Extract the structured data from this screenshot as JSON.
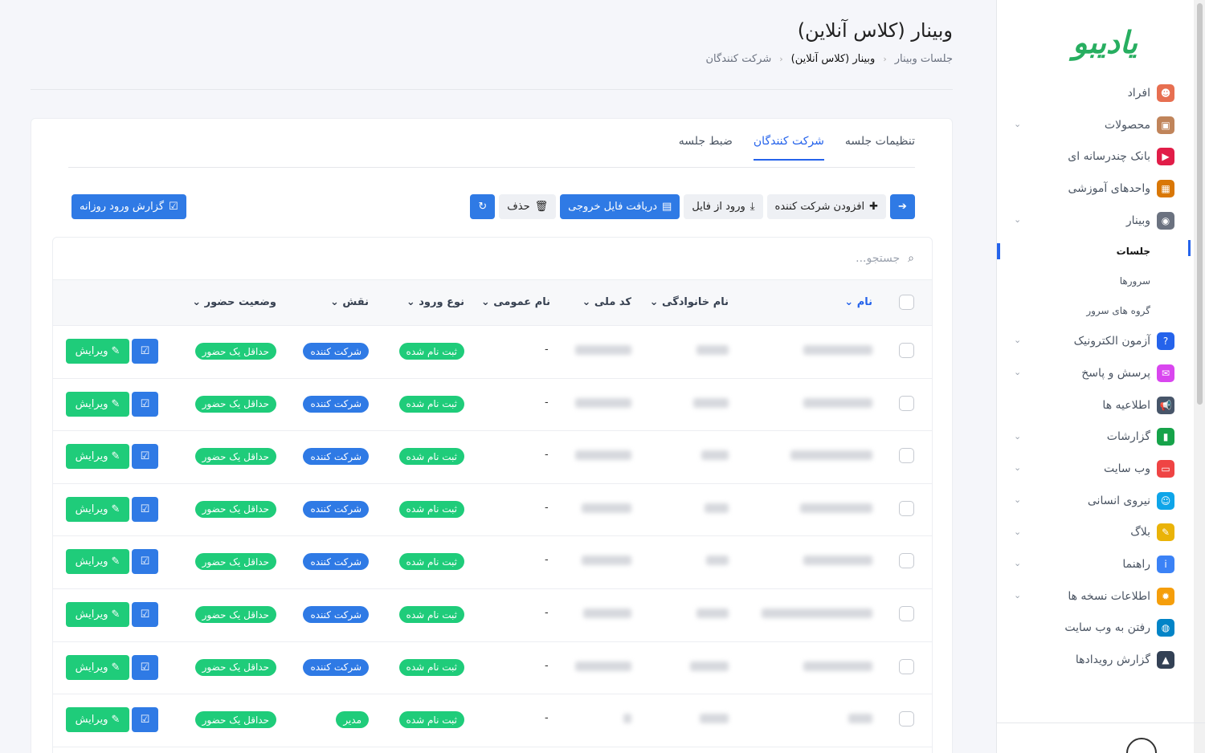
{
  "brand": {
    "logo_text": "یادیبو"
  },
  "sidebar": {
    "items": [
      {
        "label": "افراد",
        "icon": "person-icon",
        "color": "#e76f51",
        "chevron": false
      },
      {
        "label": "محصولات",
        "icon": "box-icon",
        "color": "#c0845a",
        "chevron": true
      },
      {
        "label": "بانک چندرسانه ای",
        "icon": "play-icon",
        "color": "#e11d48",
        "chevron": false
      },
      {
        "label": "واحدهای آموزشی",
        "icon": "school-icon",
        "color": "#d97706",
        "chevron": false
      },
      {
        "label": "وبینار",
        "icon": "webinar-icon",
        "color": "#6b7280",
        "chevron": true
      }
    ],
    "sub_items": [
      {
        "label": "جلسات",
        "active": true
      },
      {
        "label": "سرورها",
        "active": false
      },
      {
        "label": "گروه های سرور",
        "active": false
      }
    ],
    "items2": [
      {
        "label": "آزمون الکترونیک",
        "icon": "question-icon",
        "color": "#2563eb",
        "chevron": true
      },
      {
        "label": "پرسش و پاسخ",
        "icon": "chat-icon",
        "color": "#d946ef",
        "chevron": true
      },
      {
        "label": "اطلاعیه ها",
        "icon": "megaphone-icon",
        "color": "#475569",
        "chevron": false
      },
      {
        "label": "گزارشات",
        "icon": "bar-chart-icon",
        "color": "#16a34a",
        "chevron": true
      },
      {
        "label": "وب سایت",
        "icon": "browser-icon",
        "color": "#ef4444",
        "chevron": true
      },
      {
        "label": "نیروی انسانی",
        "icon": "team-icon",
        "color": "#0ea5e9",
        "chevron": true
      },
      {
        "label": "بلاگ",
        "icon": "pencil-icon",
        "color": "#eab308",
        "chevron": true
      },
      {
        "label": "راهنما",
        "icon": "info-icon",
        "color": "#3b82f6",
        "chevron": true
      },
      {
        "label": "اطلاعات نسخه ها",
        "icon": "gear-icon",
        "color": "#f59e0b",
        "chevron": true
      },
      {
        "label": "رفتن به وب سایت",
        "icon": "globe-icon",
        "color": "#0284c7",
        "chevron": false
      },
      {
        "label": "گزارش رویدادها",
        "icon": "warning-icon",
        "color": "#334155",
        "chevron": false
      }
    ]
  },
  "header": {
    "title": "وبینار (کلاس آنلاین)",
    "breadcrumb": [
      "جلسات وبینار",
      "وبینار (کلاس آنلاین)",
      "شرکت کنندگان"
    ]
  },
  "tabs": [
    {
      "label": "تنظیمات جلسه",
      "active": false
    },
    {
      "label": "شرکت کنندگان",
      "active": true
    },
    {
      "label": "ضبط جلسه",
      "active": false
    }
  ],
  "toolbar": {
    "add_label": "افزودن شرکت کننده",
    "import_label": "ورود از فایل",
    "export_label": "دریافت فایل خروجی",
    "delete_label": "حذف",
    "report_label": "گزارش ورود روزانه"
  },
  "search": {
    "placeholder": "جستجو..."
  },
  "table": {
    "columns": [
      "نام",
      "نام خانوادگی",
      "کد ملی",
      "نام عمومی",
      "نوع ورود",
      "نقش",
      "وضعیت حضور"
    ],
    "rows": [
      {
        "public_name": "-",
        "login_type": "ثبت نام شده",
        "role": "شرکت کننده",
        "role_color": "#2f7ae5",
        "status": "حداقل یک حضور"
      },
      {
        "public_name": "-",
        "login_type": "ثبت نام شده",
        "role": "شرکت کننده",
        "role_color": "#2f7ae5",
        "status": "حداقل یک حضور"
      },
      {
        "public_name": "-",
        "login_type": "ثبت نام شده",
        "role": "شرکت کننده",
        "role_color": "#2f7ae5",
        "status": "حداقل یک حضور"
      },
      {
        "public_name": "-",
        "login_type": "ثبت نام شده",
        "role": "شرکت کننده",
        "role_color": "#2f7ae5",
        "status": "حداقل یک حضور"
      },
      {
        "public_name": "-",
        "login_type": "ثبت نام شده",
        "role": "شرکت کننده",
        "role_color": "#2f7ae5",
        "status": "حداقل یک حضور"
      },
      {
        "public_name": "-",
        "login_type": "ثبت نام شده",
        "role": "شرکت کننده",
        "role_color": "#2f7ae5",
        "status": "حداقل یک حضور"
      },
      {
        "public_name": "-",
        "login_type": "ثبت نام شده",
        "role": "شرکت کننده",
        "role_color": "#2f7ae5",
        "status": "حداقل یک حضور"
      },
      {
        "public_name": "-",
        "login_type": "ثبت نام شده",
        "role": "مدیر",
        "role_color": "#1fcc7a",
        "status": "حداقل یک حضور"
      }
    ],
    "edit_label": "ویرایش"
  }
}
